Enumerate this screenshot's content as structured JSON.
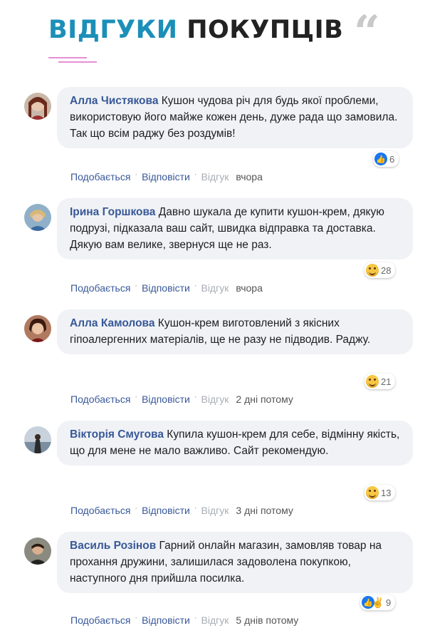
{
  "header": {
    "title_accent": "ВІДГУКИ",
    "title_rest": "ПОКУПЦІВ",
    "quote_glyph": "“",
    "accent_color": "#1b8fb8",
    "underline_color": "#e58fd5"
  },
  "actions": {
    "like": "Подобається",
    "reply": "Відповісти",
    "review": "Відгук",
    "separator": "·"
  },
  "comments": [
    {
      "name": "Алла Чистякова",
      "text": "Кушон чудова річ для будь якої проблеми, використовую його майже кожен день, дуже рада що замовила. Так що всім раджу без роздумів!",
      "reaction": "like-icon",
      "count": "6",
      "time": "вчора"
    },
    {
      "name": "Ірина Горшкова",
      "text": "Давно шукала де купити кушон-крем, дякую подрузі, підказала ваш сайт, швидка відправка та доставка. Дякую вам велике, звернуся ще не раз.",
      "reaction": "smile-icon",
      "count": "28",
      "time": "вчора"
    },
    {
      "name": "Алла Камолова",
      "text": "Кушон-крем виготовлений з якісних гіпоалергенних матеріалів, ще не разу не підводив. Раджу.",
      "reaction": "smile-icon",
      "count": "21",
      "time": "2 дні потому"
    },
    {
      "name": "Вікторія Смугова",
      "text": " Купила кушон-крем для себе, відмінну якість, що для мене не мало важливо. Сайт рекомендую.",
      "reaction": "smile-icon",
      "count": "13",
      "time": "3 дні потому"
    },
    {
      "name": "Василь Розінов",
      "text": " Гарний онлайн магазин, замовляв товар на прохання дружини, залишилася задоволена покупкою, наступного дня прийшла посилка.",
      "reaction": "like-and-hand-icons",
      "count": "9",
      "time": "5 днів потому"
    }
  ]
}
